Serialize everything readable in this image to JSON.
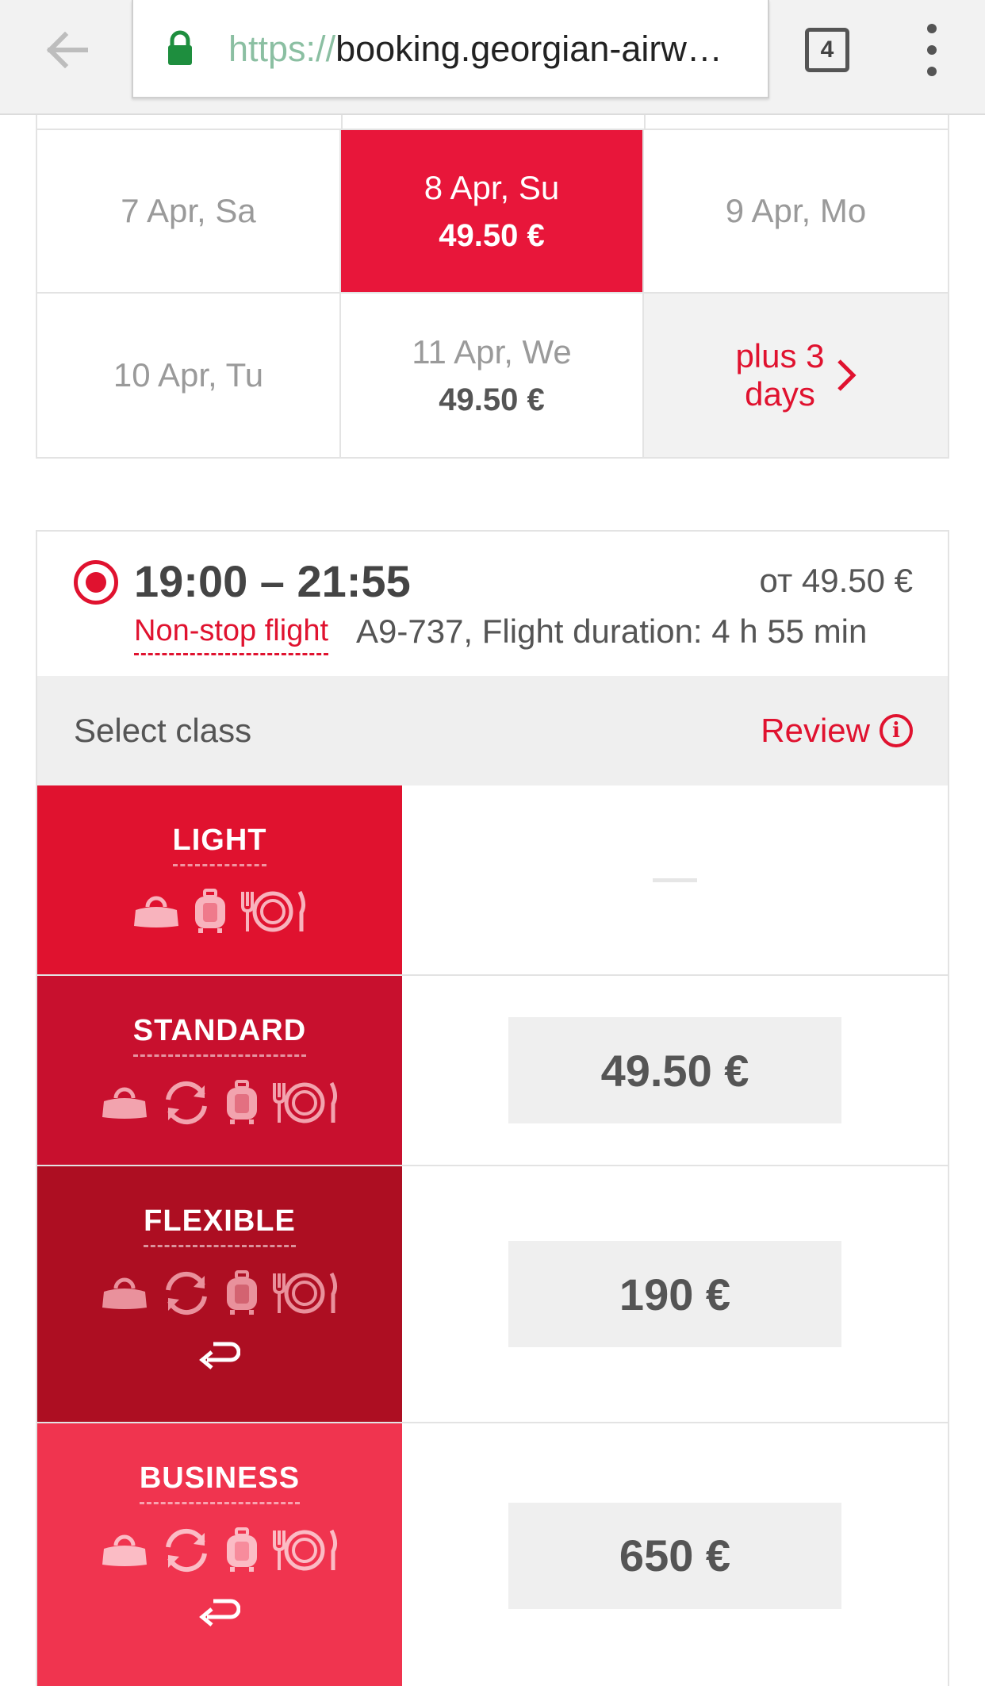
{
  "browser": {
    "url_scheme": "https://",
    "url_host": "booking.georgian-airw…",
    "tab_count": "4"
  },
  "dates": [
    {
      "label": "7 Apr, Sa",
      "price": ""
    },
    {
      "label": "8 Apr, Su",
      "price": "49.50 €",
      "selected": true
    },
    {
      "label": "9 Apr, Mo",
      "price": ""
    },
    {
      "label": "10 Apr, Tu",
      "price": ""
    },
    {
      "label": "11 Apr, We",
      "price": "49.50 €"
    }
  ],
  "more_days": {
    "line1": "plus 3",
    "line2": "days"
  },
  "flight": {
    "time": "19:00 – 21:55",
    "from_price": "от 49.50 €",
    "nonstop": "Non-stop flight",
    "info": "A9-737, Flight duration: 4 h 55 min"
  },
  "class_bar": {
    "label": "Select class",
    "review": "Review",
    "review_icon": "i"
  },
  "fares": [
    {
      "name": "LIGHT",
      "price": "",
      "color": "#e0122f",
      "icons": [
        "bag-icon",
        "carry-on-icon",
        "meal-icon"
      ]
    },
    {
      "name": "STANDARD",
      "price": "49.50 €",
      "color": "#c8102e",
      "icons": [
        "bag-icon",
        "exchange-icon",
        "carry-on-icon",
        "meal-icon"
      ]
    },
    {
      "name": "FLEXIBLE",
      "price": "190 €",
      "color": "#ad0e22",
      "icons": [
        "bag-icon",
        "exchange-icon",
        "carry-on-icon",
        "meal-icon",
        "refund-icon"
      ]
    },
    {
      "name": "BUSINESS",
      "price": "650 €",
      "color": "#f0344f",
      "icons": [
        "bag-icon",
        "exchange-icon",
        "carry-on-icon",
        "meal-icon",
        "refund-icon"
      ]
    }
  ],
  "colors": {
    "accent": "#e0122f",
    "selected_date": "#e8163a",
    "lock": "#1e8e3e"
  }
}
